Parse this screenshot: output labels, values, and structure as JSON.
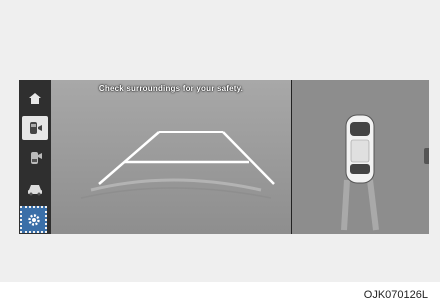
{
  "camera": {
    "caption": "Check surroundings for your safety."
  },
  "sidebar": {
    "items": [
      {
        "icon": "home-icon"
      },
      {
        "icon": "rear-camera-view-icon",
        "active": true
      },
      {
        "icon": "front-camera-view-icon"
      },
      {
        "icon": "top-view-car-icon"
      },
      {
        "icon": "settings-icon"
      }
    ]
  },
  "figure": {
    "code": "OJK070126L"
  },
  "colors": {
    "screen_bg": "#3a3a3a",
    "settings_highlight": "#3a6fa8"
  }
}
